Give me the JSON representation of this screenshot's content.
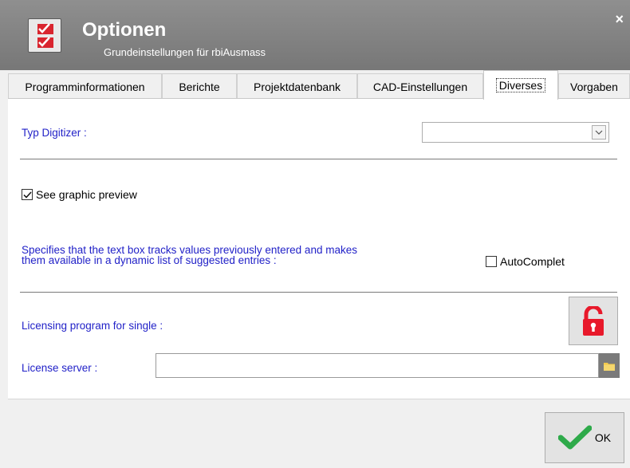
{
  "window": {
    "title": "Optionen",
    "subtitle": "Grundeinstellungen für rbiAusmass",
    "close_label": "×"
  },
  "tabs": [
    {
      "label": "Programminformationen"
    },
    {
      "label": "Berichte"
    },
    {
      "label": "Projektdatenbank"
    },
    {
      "label": "CAD-Einstellungen"
    },
    {
      "label": "Diverses",
      "active": true
    },
    {
      "label": "Vorgaben"
    }
  ],
  "diverses": {
    "digitizer_label": "Typ Digitizer :",
    "digitizer_value": "",
    "preview_label": "See graphic preview",
    "preview_checked": true,
    "autocomplete_description_line1": "Specifies that the text box tracks values previously entered and makes",
    "autocomplete_description_line2": "them available in a dynamic list of suggested entries :",
    "autocomplete_label": "AutoComplet",
    "autocomplete_checked": false,
    "licensing_label": "Licensing program for single :",
    "license_server_label": "License server :",
    "license_server_value": ""
  },
  "footer": {
    "ok_label": "OK"
  },
  "colors": {
    "label_blue": "#2222c8",
    "lock_red": "#e8192b",
    "ok_green": "#2eaa4a"
  }
}
